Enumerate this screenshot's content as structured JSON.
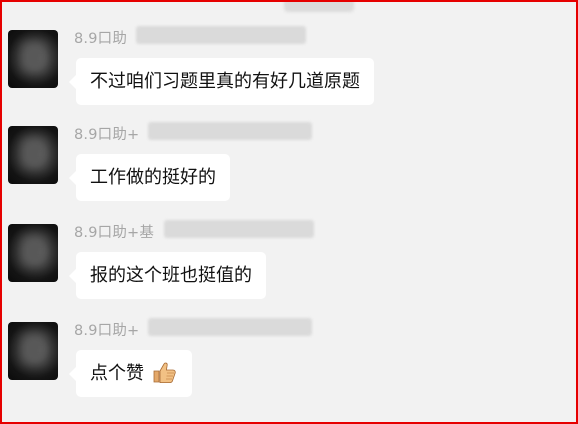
{
  "messages": [
    {
      "sender": "8.9口助",
      "text": "不过咱们习题里真的有好几道原题",
      "emoji": ""
    },
    {
      "sender": "8.9口助+",
      "text": "工作做的挺好的",
      "emoji": ""
    },
    {
      "sender": "8.9口助+基",
      "text": "报的这个班也挺值的",
      "emoji": ""
    },
    {
      "sender": "8.9口助+",
      "text": "点个赞",
      "emoji": "thumbs-up-icon"
    }
  ],
  "colors": {
    "frame_border": "#e60000",
    "chat_background": "#f2f2f2",
    "bubble": "#ffffff",
    "sender_text": "#a6a6a6",
    "message_text": "#111111"
  }
}
